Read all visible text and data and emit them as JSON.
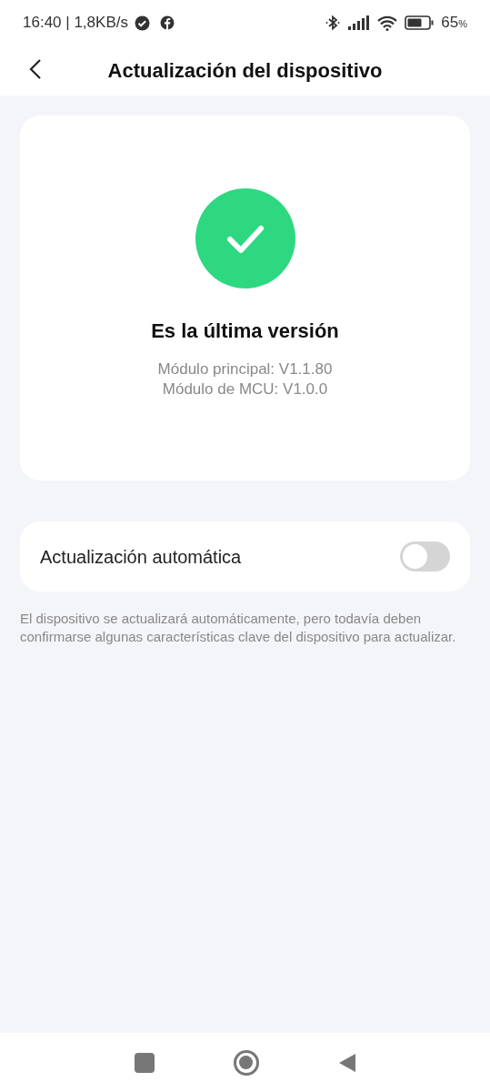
{
  "status_bar": {
    "time": "16:40 | 1,8KB/s",
    "battery": "65",
    "battery_unit": "%"
  },
  "header": {
    "title": "Actualización del dispositivo"
  },
  "status_card": {
    "title": "Es la última versión",
    "versions": [
      "Módulo principal: V1.1.80",
      "Módulo de MCU: V1.0.0"
    ]
  },
  "auto_update": {
    "label": "Actualización automática",
    "on": false
  },
  "note": "El dispositivo se actualizará automáticamente, pero todavía deben confirmarse algunas características clave del dispositivo para actualizar."
}
